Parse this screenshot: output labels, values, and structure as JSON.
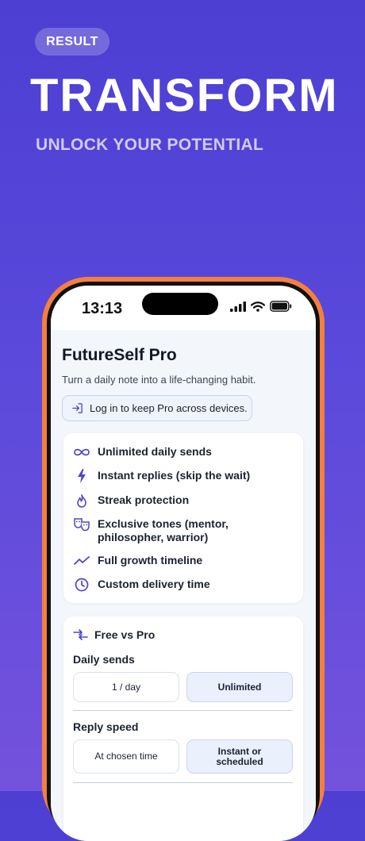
{
  "promo": {
    "badge": "RESULT",
    "headline": "TRANSFORM",
    "subheadline": "UNLOCK YOUR POTENTIAL"
  },
  "statusbar": {
    "time": "13:13",
    "icons": [
      "signal-icon",
      "wifi-icon",
      "battery-icon"
    ]
  },
  "app": {
    "title": "FutureSelf Pro",
    "tagline": "Turn a daily note into a life-changing habit.",
    "login_button": "Log in to keep Pro across devices.",
    "features": [
      {
        "icon": "infinity-icon",
        "label": "Unlimited daily sends"
      },
      {
        "icon": "lightning-icon",
        "label": "Instant replies (skip the wait)"
      },
      {
        "icon": "flame-icon",
        "label": "Streak protection"
      },
      {
        "icon": "masks-icon",
        "label": "Exclusive tones (mentor, philosopher, warrior)"
      },
      {
        "icon": "trend-up-icon",
        "label": "Full growth timeline"
      },
      {
        "icon": "clock-icon",
        "label": "Custom delivery time"
      }
    ],
    "comparison": {
      "title": "Free vs Pro",
      "rows": [
        {
          "label": "Daily sends",
          "free": "1 / day",
          "pro": "Unlimited"
        },
        {
          "label": "Reply speed",
          "free": "At chosen time",
          "pro": "Instant or scheduled"
        }
      ]
    }
  },
  "colors": {
    "background_top": "#4c3fd2",
    "background_bottom": "#7452dc",
    "phone_frame": "#f47f3e",
    "accent": "#4b45c8"
  }
}
